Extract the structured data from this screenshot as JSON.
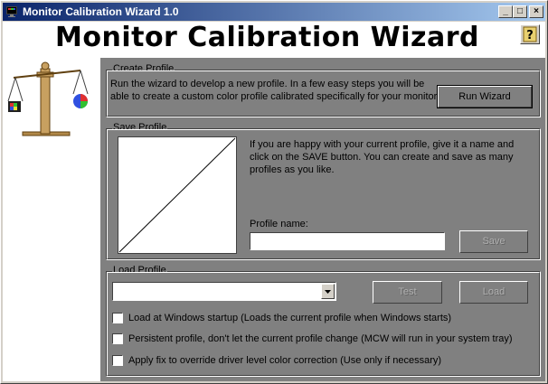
{
  "window": {
    "title": "Monitor Calibration Wizard 1.0",
    "minimize_symbol": "_",
    "maximize_symbol": "□",
    "close_symbol": "×"
  },
  "header": {
    "title": "Monitor Calibration Wizard",
    "help_glyph": "?"
  },
  "icons": {
    "app": "monitor-icon",
    "logo": "balance-scale-icon",
    "help": "question-mark-icon",
    "dropdown": "triangle-down-icon"
  },
  "create_profile": {
    "legend": "Create Profile",
    "description_line1": "Run the wizard to develop a new profile.  In a few easy steps you will be",
    "description_line2": "able to create a custom color profile calibrated specifically for your monitor.",
    "run_wizard_label": "Run Wizard"
  },
  "save_profile": {
    "legend": "Save Profile",
    "description_line1": "If you are happy with your current profile, give it a name and",
    "description_line2": "click on the SAVE button.  You can create and save as many",
    "description_line3": "profiles as you like.",
    "profile_name_label": "Profile name:",
    "profile_name_value": "",
    "save_label": "Save"
  },
  "load_profile": {
    "legend": "Load Profile",
    "selected_value": "",
    "test_label": "Test",
    "load_label": "Load",
    "options": [
      {
        "label": "Load at Windows startup (Loads the current profile when Windows starts)",
        "checked": false
      },
      {
        "label": "Persistent profile, don't let the current profile change (MCW will run in your system tray)",
        "checked": false
      },
      {
        "label": "Apply fix to override driver level color correction (Use only if necessary)",
        "checked": false
      }
    ]
  }
}
